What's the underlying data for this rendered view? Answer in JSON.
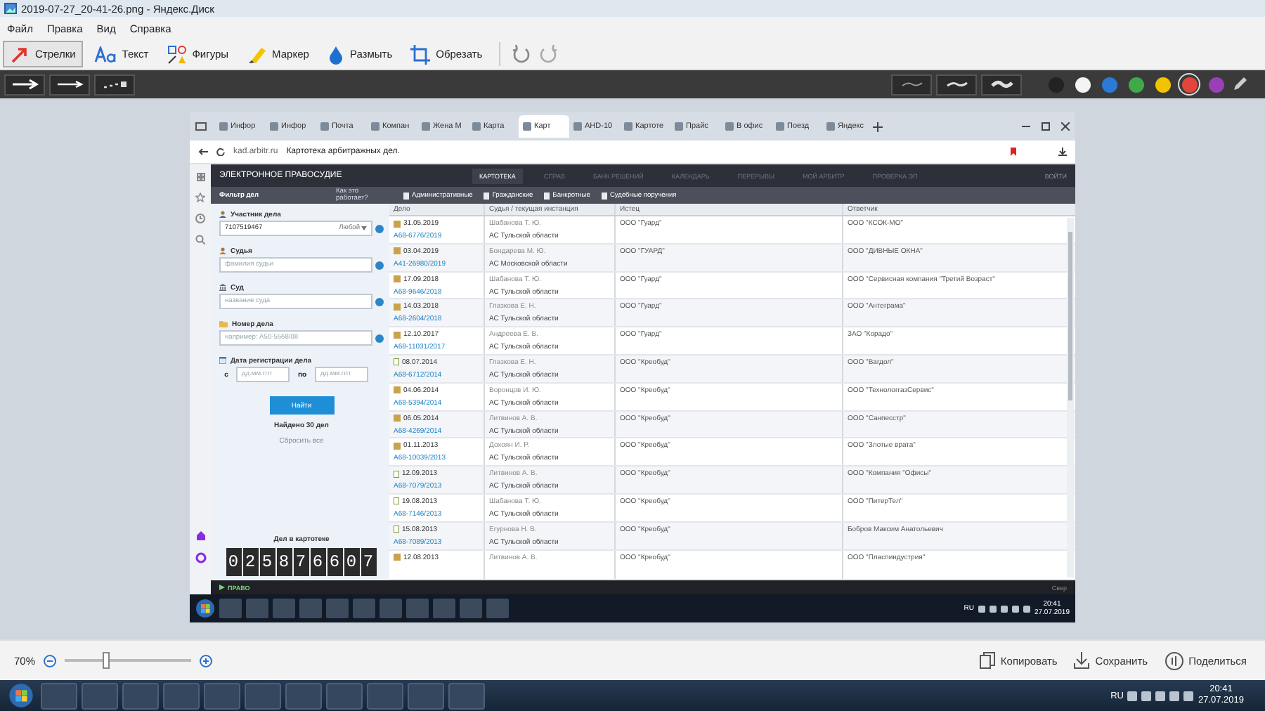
{
  "window": {
    "title": "2019-07-27_20-41-26.png - Яндекс.Диск"
  },
  "menu": [
    "Файл",
    "Правка",
    "Вид",
    "Справка"
  ],
  "tools": [
    {
      "label": "Стрелки",
      "kind": "arrow",
      "selected": true
    },
    {
      "label": "Текст",
      "kind": "text",
      "selected": false
    },
    {
      "label": "Фигуры",
      "kind": "shapes",
      "selected": false
    },
    {
      "label": "Маркер",
      "kind": "marker",
      "selected": false
    },
    {
      "label": "Размыть",
      "kind": "blur",
      "selected": false
    },
    {
      "label": "Обрезать",
      "kind": "crop",
      "selected": false
    }
  ],
  "colors": [
    {
      "color": "#222222",
      "selected": false
    },
    {
      "color": "#f4f4f4",
      "selected": false
    },
    {
      "color": "#2b7bd6",
      "selected": false
    },
    {
      "color": "#3faa4a",
      "selected": false
    },
    {
      "color": "#f2c300",
      "selected": false
    },
    {
      "color": "#e2463a",
      "selected": true
    },
    {
      "color": "#9a3fb8",
      "selected": false
    }
  ],
  "screenshot": {
    "tabs": [
      {
        "label": "Инфор",
        "selected": false
      },
      {
        "label": "Инфор",
        "selected": false
      },
      {
        "label": "Почта",
        "selected": false
      },
      {
        "label": "Компан",
        "selected": false
      },
      {
        "label": "Жена М",
        "selected": false
      },
      {
        "label": "Карта",
        "selected": false
      },
      {
        "label": "Карт",
        "selected": true
      },
      {
        "label": "AHD-10",
        "selected": false
      },
      {
        "label": "Картоте",
        "selected": false
      },
      {
        "label": "Прайс",
        "selected": false
      },
      {
        "label": "В офис",
        "selected": false
      },
      {
        "label": "Поезд",
        "selected": false
      },
      {
        "label": "Яндекс",
        "selected": false
      }
    ],
    "address": {
      "domain": "kad.arbitr.ru",
      "page_title": "Картотека арбитражных дел."
    },
    "site": {
      "logo": "ЭЛЕКТРОННОЕ ПРАВОСУДИЕ",
      "nav": [
        {
          "label": "КАРТОТЕКА",
          "selected": true
        },
        {
          "label": "СПРАВ",
          "selected": false
        },
        {
          "label": "БАНК РЕШЕНИЙ",
          "selected": false
        },
        {
          "label": "КАЛЕНДАРЬ",
          "selected": false
        },
        {
          "label": "ПЕРЕРЫВЫ",
          "selected": false
        },
        {
          "label": "МОЙ АРБИТР",
          "selected": false
        },
        {
          "label": "ПРОВЕРКА ЭП",
          "selected": false
        }
      ],
      "login": "ВОЙТИ"
    },
    "filter_bar": {
      "title": "Фильтр дел",
      "help": "Как это работает?",
      "categories": [
        "Административные",
        "Гражданские",
        "Банкротные",
        "Судебные поручения"
      ]
    },
    "filters": {
      "participant": {
        "label": "Участник дела",
        "value": "7107519467",
        "role": "Любой"
      },
      "judge": {
        "label": "Судья",
        "placeholder": "фамилия судьи"
      },
      "court": {
        "label": "Суд",
        "placeholder": "название суда"
      },
      "case_number": {
        "label": "Номер дела",
        "placeholder": "например: А50-5568/08"
      },
      "date": {
        "label": "Дата регистрации дела",
        "from_label": "с",
        "from_placeholder": "дд.мм.гггг",
        "to_label": "по",
        "to_placeholder": "дд.мм.гггг"
      },
      "search_button": "Найти",
      "found": "Найдено 30 дел",
      "reset": "Сбросить все"
    },
    "counter": {
      "label": "Дел в картотеке",
      "value": "025876607"
    },
    "table": {
      "columns": [
        "Дело",
        "Судья / текущая инстанция",
        "Истец",
        "Ответчик"
      ],
      "rows": [
        {
          "kind": "folder",
          "date": "31.05.2019",
          "case": "А68-6776/2019",
          "judge": "Шабанова Т. Ю.",
          "court": "АС Тульской области",
          "plaintiff": "ООО \"Гуард\"",
          "defendant": "ООО \"КСОК-МО\""
        },
        {
          "kind": "folder",
          "date": "03.04.2019",
          "case": "А41-26980/2019",
          "judge": "Бондарева М. Ю.",
          "court": "АС Московской области",
          "plaintiff": "ООО \"ГУАРД\"",
          "defendant": "ООО \"ДИВНЫЕ ОКНА\""
        },
        {
          "kind": "folder",
          "date": "17.09.2018",
          "case": "А68-9646/2018",
          "judge": "Шабанова Т. Ю.",
          "court": "АС Тульской области",
          "plaintiff": "ООО \"Гуард\"",
          "defendant": "ООО \"Сервисная компания \"Третий Возраст\""
        },
        {
          "kind": "folder",
          "date": "14.03.2018",
          "case": "А68-2604/2018",
          "judge": "Глазкова Е. Н.",
          "court": "АС Тульской области",
          "plaintiff": "ООО \"Гуард\"",
          "defendant": "ООО \"Антеграма\""
        },
        {
          "kind": "folder",
          "date": "12.10.2017",
          "case": "А68-11031/2017",
          "judge": "Андреева Е. В.",
          "court": "АС Тульской области",
          "plaintiff": "ООО \"Гуард\"",
          "defendant": "ЗАО \"Корадо\""
        },
        {
          "kind": "document",
          "date": "08.07.2014",
          "case": "А68-6712/2014",
          "judge": "Глазкова Е. Н.",
          "court": "АС Тульской области",
          "plaintiff": "ООО \"Креобуд\"",
          "defendant": "ООО \"Вагдол\""
        },
        {
          "kind": "folder",
          "date": "04.06.2014",
          "case": "А68-5394/2014",
          "judge": "Воронцов И. Ю.",
          "court": "АС Тульской области",
          "plaintiff": "ООО \"Креобуд\"",
          "defendant": "ООО \"ТехнологгазСервис\""
        },
        {
          "kind": "folder",
          "date": "06.05.2014",
          "case": "А68-4269/2014",
          "judge": "Литвинов А. В.",
          "court": "АС Тульской области",
          "plaintiff": "ООО \"Креобуд\"",
          "defendant": "ООО \"Санпесстр\""
        },
        {
          "kind": "folder",
          "date": "01.11.2013",
          "case": "А68-10039/2013",
          "judge": "Дохоян И. Р.",
          "court": "АС Тульской области",
          "plaintiff": "ООО \"Креобуд\"",
          "defendant": "ООО \"Злотые врата\""
        },
        {
          "kind": "document",
          "date": "12.09.2013",
          "case": "А68-7079/2013",
          "judge": "Литвинов А. В.",
          "court": "АС Тульской области",
          "plaintiff": "ООО \"Креобуд\"",
          "defendant": "ООО \"Компания \"Офисы\""
        },
        {
          "kind": "document",
          "date": "19.08.2013",
          "case": "А68-7146/2013",
          "judge": "Шабанова Т. Ю.",
          "court": "АС Тульской области",
          "plaintiff": "ООО \"Креобуд\"",
          "defendant": "ООО \"ПитерТел\""
        },
        {
          "kind": "document",
          "date": "15.08.2013",
          "case": "А68-7089/2013",
          "judge": "Егурнова Н. В.",
          "court": "АС Тульской области",
          "plaintiff": "ООО \"Креобуд\"",
          "defendant": "Бобров Максим Анатольевич"
        },
        {
          "kind": "folder",
          "date": "12.08.2013",
          "judge": "Литвинов А. В.",
          "plaintiff": "ООО \"Креобуд\"",
          "defendant": "ООО \"Пласпиндустрия\""
        }
      ]
    },
    "footer": {
      "brand": "ПРАВО",
      "collapse": "Свер"
    },
    "taskbar": {
      "language": "RU",
      "time": "20:41",
      "date": "27.07.2019"
    }
  },
  "zoom": {
    "label": "70%",
    "level": 0.32
  },
  "actions": [
    "Копировать",
    "Сохранить",
    "Поделиться"
  ],
  "taskbar": {
    "language": "RU",
    "time": "20:41",
    "date": "27.07.2019"
  }
}
